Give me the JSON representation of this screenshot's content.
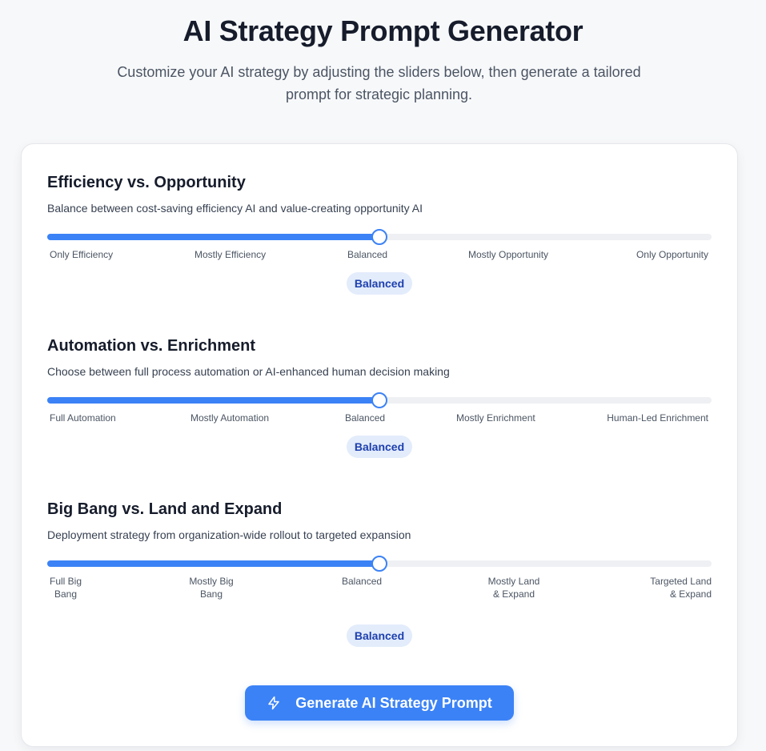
{
  "header": {
    "title": "AI Strategy Prompt Generator",
    "subtitle": "Customize your AI strategy by adjusting the sliders below, then generate a tailored prompt for strategic planning."
  },
  "sliders": [
    {
      "title": "Efficiency vs. Opportunity",
      "description": "Balance between cost-saving efficiency AI and value-creating opportunity AI",
      "value_fraction": 0.5,
      "ticks": [
        "Only Efficiency",
        "Mostly Efficiency",
        "Balanced",
        "Mostly Opportunity",
        "Only Opportunity"
      ],
      "current_label": "Balanced"
    },
    {
      "title": "Automation vs. Enrichment",
      "description": "Choose between full process automation or AI-enhanced human decision making",
      "value_fraction": 0.5,
      "ticks": [
        "Full Automation",
        "Mostly Automation",
        "Balanced",
        "Mostly Enrichment",
        "Human-Led Enrichment"
      ],
      "current_label": "Balanced"
    },
    {
      "title": "Big Bang vs. Land and Expand",
      "description": "Deployment strategy from organization-wide rollout to targeted expansion",
      "value_fraction": 0.5,
      "ticks": [
        "Full Big Bang",
        "Mostly Big Bang",
        "Balanced",
        "Mostly Land & Expand",
        "Targeted Land & Expand"
      ],
      "current_label": "Balanced"
    }
  ],
  "generate_button": {
    "label": "Generate AI Strategy Prompt",
    "icon": "lightning-bolt-icon"
  },
  "colors": {
    "accent": "#3b82f6",
    "badge_bg": "#e3ecfb",
    "badge_text": "#1e40af"
  }
}
